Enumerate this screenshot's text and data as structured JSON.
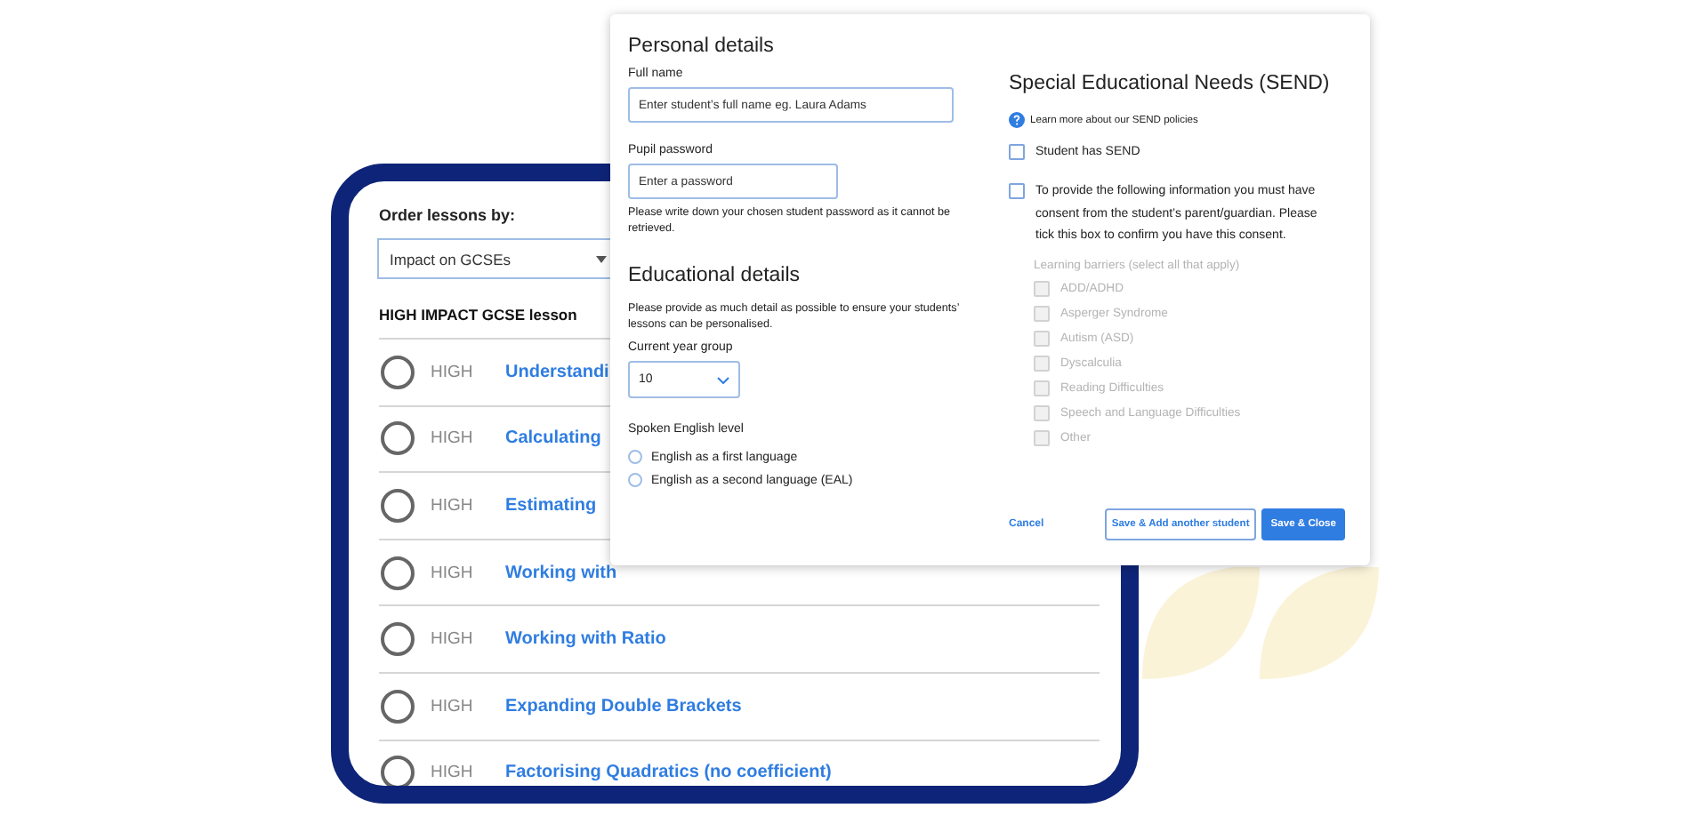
{
  "order_panel": {
    "label": "Order lessons by:",
    "sort_select": {
      "value": "Impact on GCSEs"
    },
    "section_title": "HIGH IMPACT GCSE lesson",
    "lessons": [
      {
        "checked": false,
        "impact": "HIGH",
        "title": "Understandi"
      },
      {
        "checked": false,
        "impact": "HIGH",
        "title": "Calculating"
      },
      {
        "checked": false,
        "impact": "HIGH",
        "title": "Estimating"
      },
      {
        "checked": false,
        "impact": "HIGH",
        "title": "Working with"
      },
      {
        "checked": false,
        "impact": "HIGH",
        "title": "Working with Ratio"
      },
      {
        "checked": false,
        "impact": "HIGH",
        "title": "Expanding Double Brackets"
      },
      {
        "checked": false,
        "impact": "HIGH",
        "title": "Factorising Quadratics (no coefficient)"
      }
    ]
  },
  "student_form": {
    "personal": {
      "heading": "Personal details",
      "full_name": {
        "label": "Full name",
        "placeholder": "Enter student’s full name eg. Laura Adams"
      },
      "password": {
        "label": "Pupil password",
        "placeholder": "Enter a password",
        "hint": "Please write down your chosen student password as it cannot be retrieved."
      }
    },
    "educational": {
      "heading": "Educational details",
      "intro": "Please provide as much detail as possible to ensure your students’ lessons can be personalised.",
      "year_group": {
        "label": "Current year group",
        "value": "10"
      },
      "english_level": {
        "label": "Spoken English level",
        "options": [
          {
            "label": "English as a first language",
            "selected": false
          },
          {
            "label": "English as a second language (EAL)",
            "selected": false
          }
        ]
      }
    },
    "send": {
      "heading": "Special Educational Needs (SEND)",
      "help_link": "Learn more about our SEND policies",
      "has_send": {
        "label": "Student has SEND",
        "checked": false
      },
      "consent": {
        "label": "To provide the following information you must have consent from the student’s parent/guardian. Please tick this box to confirm you have this consent.",
        "checked": false
      },
      "barriers": {
        "label": "Learning barriers (select all that apply)",
        "disabled": true,
        "options": [
          {
            "label": "ADD/ADHD",
            "checked": false
          },
          {
            "label": "Asperger Syndrome",
            "checked": false
          },
          {
            "label": "Autism (ASD)",
            "checked": false
          },
          {
            "label": "Dyscalculia",
            "checked": false
          },
          {
            "label": "Reading Difficulties",
            "checked": false
          },
          {
            "label": "Speech and Language Difficulties",
            "checked": false
          },
          {
            "label": "Other",
            "checked": false
          }
        ]
      }
    },
    "actions": {
      "cancel": "Cancel",
      "save_add": "Save & Add another student",
      "save_close": "Save & Close"
    }
  }
}
